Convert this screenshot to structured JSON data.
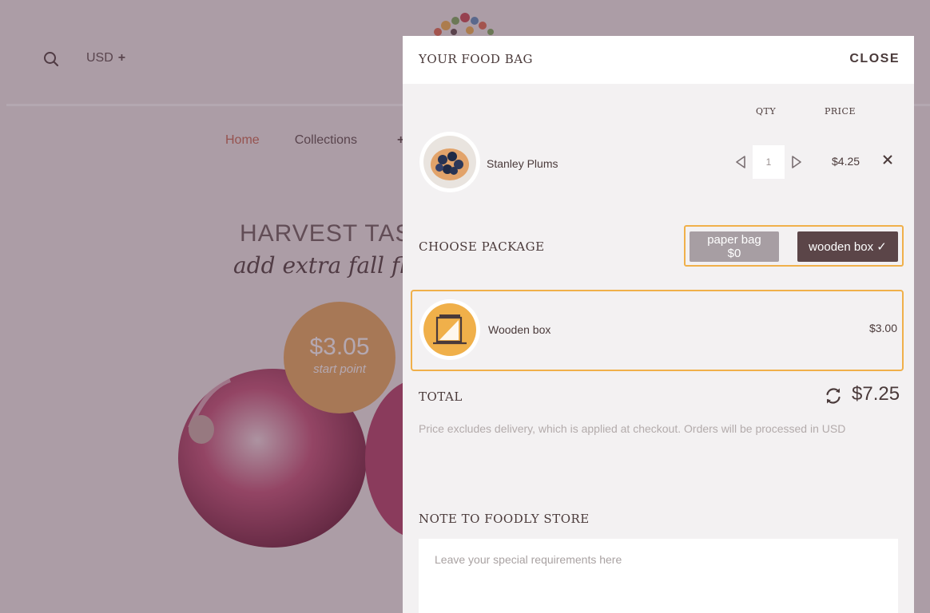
{
  "header": {
    "currency": "USD",
    "currency_plus": "+"
  },
  "nav": {
    "items": [
      {
        "label": "Home"
      },
      {
        "label": "Collections"
      }
    ],
    "collections_plus": "+"
  },
  "hero": {
    "title": "HARVEST TAS",
    "subtitle": "add extra fall flav",
    "price": "$3.05",
    "price_label": "start point"
  },
  "cart": {
    "title": "YOUR FOOD BAG",
    "close_label": "CLOSE",
    "columns": {
      "qty": "QTY",
      "price": "PRICE"
    },
    "items": [
      {
        "name": "Stanley Plums",
        "qty": "1",
        "price": "$4.25"
      }
    ],
    "choose_package_label": "CHOOSE PACKAGE",
    "packages": [
      {
        "label": "paper bag $0",
        "selected": false
      },
      {
        "label": "wooden box ✓",
        "selected": true
      }
    ],
    "selected_package": {
      "name": "Wooden box",
      "price": "$3.00"
    },
    "total_label": "TOTAL",
    "total": "$7.25",
    "delivery_note": "Price excludes delivery, which is applied at checkout. Orders will be processed in USD",
    "note_label": "NOTE TO FOODLY STORE",
    "note_placeholder": "Leave your special requirements here"
  },
  "colors": {
    "accent": "#f0b04a",
    "selected_button": "#5b4548",
    "unselected_button": "#a79ea3",
    "price_badge": "#e8a85a",
    "nav_active": "#c8644e"
  },
  "icons": {
    "search": "search-icon",
    "refresh": "refresh-icon",
    "remove": "close-x-icon",
    "qty_decrease": "triangle-left-icon",
    "qty_increase": "triangle-right-icon",
    "package": "wooden-box-icon"
  }
}
